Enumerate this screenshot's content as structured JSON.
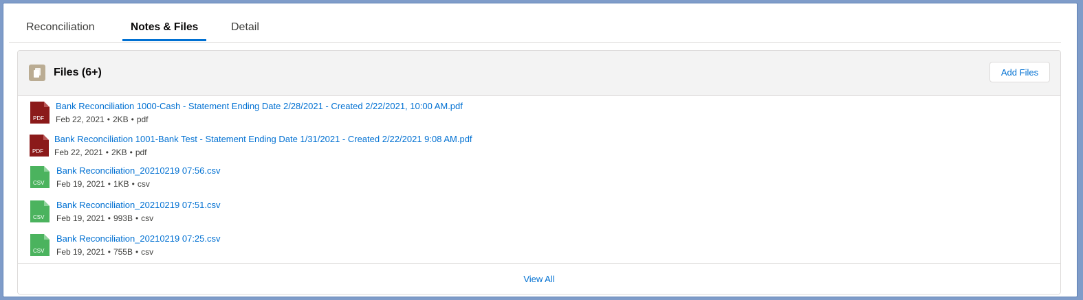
{
  "tabs": [
    {
      "label": "Reconciliation"
    },
    {
      "label": "Notes & Files"
    },
    {
      "label": "Detail"
    }
  ],
  "files_card": {
    "title": "Files (6+)",
    "add_button": "Add Files",
    "view_all": "View All",
    "items": [
      {
        "name": "Bank Reconciliation 1000-Cash - Statement Ending Date 2/28/2021 - Created 2/22/2021, 10:00 AM.pdf",
        "date": "Feb 22, 2021",
        "size": "2KB",
        "ext": "pdf",
        "icon": "pdf-file-icon",
        "icon_label": "PDF"
      },
      {
        "name": "Bank Reconciliation 1001-Bank Test - Statement Ending Date 1/31/2021 - Created 2/22/2021 9:08 AM.pdf",
        "date": "Feb 22, 2021",
        "size": "2KB",
        "ext": "pdf",
        "icon": "pdf-file-icon",
        "icon_label": "PDF"
      },
      {
        "name": "Bank Reconciliation_20210219 07:56.csv",
        "date": "Feb 19, 2021",
        "size": "1KB",
        "ext": "csv",
        "icon": "csv-file-icon",
        "icon_label": "CSV"
      },
      {
        "name": "Bank Reconciliation_20210219 07:51.csv",
        "date": "Feb 19, 2021",
        "size": "993B",
        "ext": "csv",
        "icon": "csv-file-icon",
        "icon_label": "CSV"
      },
      {
        "name": "Bank Reconciliation_20210219 07:25.csv",
        "date": "Feb 19, 2021",
        "size": "755B",
        "ext": "csv",
        "icon": "csv-file-icon",
        "icon_label": "CSV"
      }
    ]
  },
  "colors": {
    "link": "#0070d2",
    "pdf_icon": "#8b1a1a",
    "csv_icon": "#4bb35e",
    "files_icon": "#baac93",
    "annotation_arrow": "#e8473c"
  }
}
